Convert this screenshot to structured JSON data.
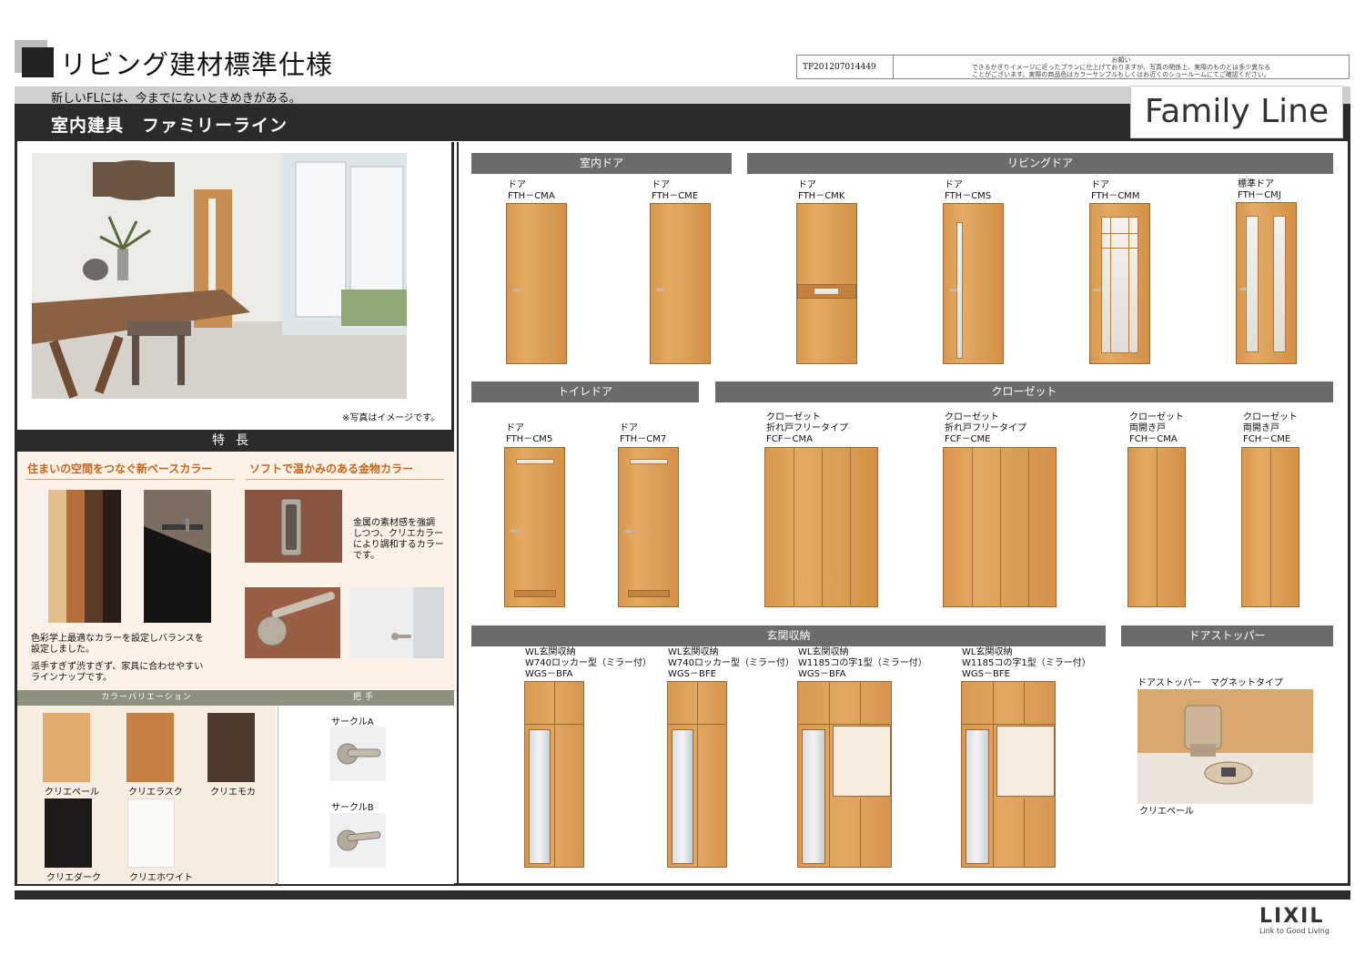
{
  "header": {
    "title": "リビング建材標準仕様",
    "subtitle": "新しいFLには、今までにないときめきがある。",
    "section_title": "室内建具　ファミリーライン",
    "logo": "Family Line",
    "notice_id": "TP201207014449",
    "notice_head": "お願い",
    "notice_line1": "できるかぎりイメージに近ったプランに仕上げておりますが、写真の関係上、実際のものとは多少異なる",
    "notice_line2": "ことがございます。実際の商品色はカラーサンプルもしくはお近くのショールームにてご確認ください。"
  },
  "left": {
    "photo_note": "※写真はイメージです。",
    "feature_head": "特長",
    "feature1_title": "住まいの空間をつなぐ新ベースカラー",
    "feature2_title": "ソフトで温かみのある金物カラー",
    "feature1_text1": "色彩学上最適なカラーを設定しバランスを",
    "feature1_text2": "設定しました。",
    "feature1_text3": "派手すぎず渋すぎず、家具に合わせやすい",
    "feature1_text4": "ラインナップです。",
    "feature2_text1": "金属の素材感を強調",
    "feature2_text2": "しつつ、クリエカラー",
    "feature2_text3": "により調和するカラー",
    "feature2_text4": "です。",
    "variation_head": "カラーバリエーション",
    "handle_head": "把手",
    "swatches": [
      {
        "label": "クリエペール",
        "color": "#e0ac6e"
      },
      {
        "label": "クリエラスク",
        "color": "#c77f44"
      },
      {
        "label": "クリエモカ",
        "color": "#4e3a2c"
      },
      {
        "label": "クリエダーク",
        "color": "#1d1a19"
      },
      {
        "label": "クリエホワイト",
        "color": "#fbf9f5"
      }
    ],
    "handles": [
      {
        "label": "サークルA"
      },
      {
        "label": "サークルB"
      }
    ]
  },
  "categories": {
    "interior": "室内ドア",
    "living": "リビングドア",
    "toilet": "トイレドア",
    "closet": "クローゼット",
    "entrance": "玄関収納",
    "stopper": "ドアストッパー"
  },
  "doors": [
    {
      "l1": "ドア",
      "l2": "FTH－CMA"
    },
    {
      "l1": "ドア",
      "l2": "FTH－CME"
    },
    {
      "l1": "ドア",
      "l2": "FTH－CMK"
    },
    {
      "l1": "ドア",
      "l2": "FTH－CMS"
    },
    {
      "l1": "ドア",
      "l2": "FTH－CMM"
    },
    {
      "l1": "標準ドア",
      "l2": "FTH－CMJ"
    }
  ],
  "toilet_doors": [
    {
      "l1": "ドア",
      "l2": "FTH－CM5"
    },
    {
      "l1": "ドア",
      "l2": "FTH－CM7"
    }
  ],
  "closets": [
    {
      "l1": "クローゼット",
      "l2": "折れ戸フリータイプ",
      "l3": "FCF－CMA"
    },
    {
      "l1": "クローゼット",
      "l2": "折れ戸フリータイプ",
      "l3": "FCF－CME"
    },
    {
      "l1": "クローゼット",
      "l2": "両開き戸",
      "l3": "FCH－CMA"
    },
    {
      "l1": "クローゼット",
      "l2": "両開き戸",
      "l3": "FCH－CME"
    }
  ],
  "entrance": [
    {
      "l1": "WL玄関収納",
      "l2": "W740ロッカー型（ミラー付）",
      "l3": "WGS－BFA"
    },
    {
      "l1": "WL玄関収納",
      "l2": "W740ロッカー型（ミラー付）",
      "l3": "WGS－BFE"
    },
    {
      "l1": "WL玄関収納",
      "l2": "W1185コの字1型（ミラー付）",
      "l3": "WGS－BFA"
    },
    {
      "l1": "WL玄関収納",
      "l2": "W1185コの字1型（ミラー付）",
      "l3": "WGS－BFE"
    }
  ],
  "stopper": {
    "title": "ドアストッパー　マグネットタイプ",
    "color": "クリエペール"
  },
  "footer": {
    "brand": "LIXIL",
    "tagline": "Link to Good Living"
  }
}
